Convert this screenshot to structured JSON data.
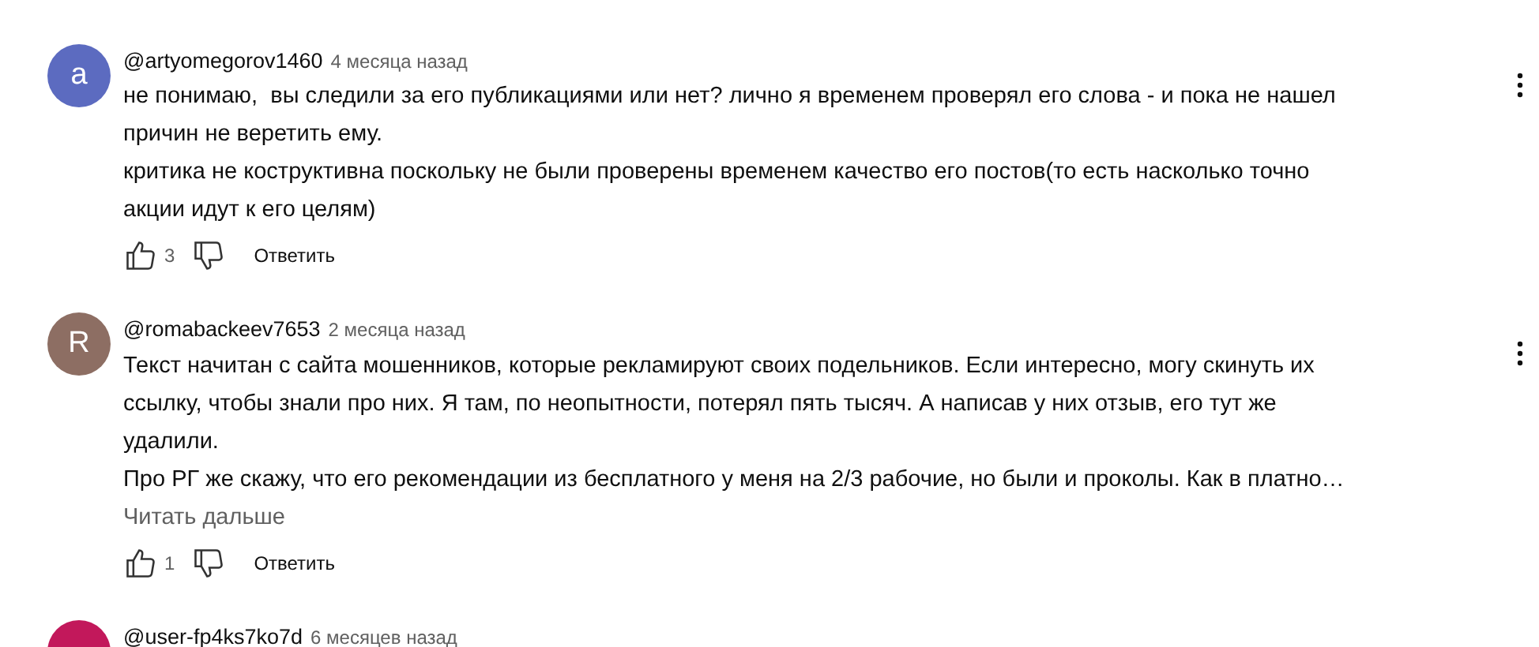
{
  "comments": [
    {
      "avatar_letter": "a",
      "color": "#5c6bc0",
      "handle": "@artyomegorov1460",
      "time": "4 месяца назад",
      "paragraphs": [
        [
          "не понимаю,  вы следили за его публикациями или нет? лично я временем проверял его слова - и пока не нашел",
          "причин не веретить ему."
        ],
        [
          "критика не кострyктивна поскольку не были проверены временем качество его постов(то есть насколько точно",
          "акции идут к его целям)"
        ]
      ],
      "likes": "3",
      "reply": "Ответить"
    },
    {
      "avatar_letter": "R",
      "color": "#8d6e63",
      "handle": "@romabackeev7653",
      "time": "2 месяца назад",
      "paragraphs": [
        [
          "Текст начитан с сайта мошенников, которые рекламируют своих подельников. Если интересно, могу скинуть их",
          "ссылку, чтобы знали про них. Я там, по неопытности, потерял пять тысяч. А написав у них отзыв, его тут же",
          "удалили."
        ],
        [
          "Про РГ же скажу, что его рекомендации из бесплатного у меня на 2/3 рабочие, но были и проколы. Как в платно…"
        ]
      ],
      "read_more": "Читать дальше",
      "likes": "1",
      "reply": "Ответить"
    },
    {
      "color": "#c2185b",
      "handle": "@user-fp4ks7ko7d",
      "time": "6 месяцев назад"
    }
  ]
}
